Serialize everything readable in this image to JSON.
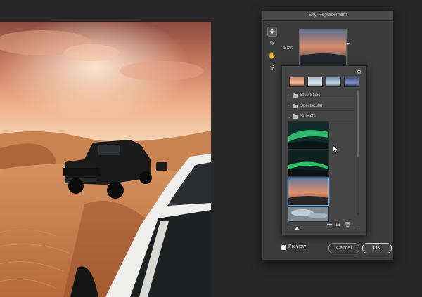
{
  "dialog": {
    "title": "Sky Replacement",
    "sky_label": "Sky:",
    "preview_label": "Preview",
    "preview_checked": true,
    "cancel_label": "Cancel",
    "ok_label": "OK"
  },
  "toolbar": {
    "tools": [
      {
        "name": "move-tool-icon",
        "glyph": "✥"
      },
      {
        "name": "sky-brush-tool-icon",
        "glyph": "✎"
      },
      {
        "name": "hand-tool-icon",
        "glyph": "✋"
      },
      {
        "name": "zoom-tool-icon",
        "glyph": "⚲"
      }
    ]
  },
  "presets": {
    "folders": [
      {
        "label": "Blue Skies"
      },
      {
        "label": "Spectacular"
      },
      {
        "label": "Sunsets"
      }
    ],
    "gear_glyph": "⚙",
    "bottom_icons": [
      "folder-icon",
      "new-preset-icon",
      "trash-icon"
    ]
  },
  "colors": {
    "accent_selection": "#6fa8d4",
    "slider_highlight": "#c9c923"
  }
}
